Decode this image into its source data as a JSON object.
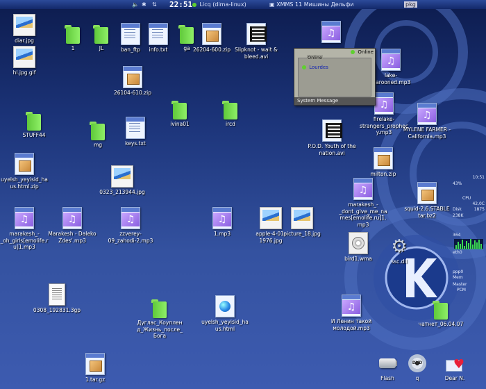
{
  "topbar": {
    "clock": "22:51",
    "licq_status": "Licq (dima-linux)",
    "xmms_label": "XMMS",
    "xmms_track": "11  Мишины Дельфи",
    "indicator": "pkg"
  },
  "licq": {
    "status": "Online",
    "group": "Online",
    "contact": "Lourdes",
    "footer": "System Message"
  },
  "sysmon": {
    "time": "10:51",
    "percent": "43%",
    "cpu": "CPU",
    "temp": "42,0C",
    "freq": "1875",
    "disk": "Disk",
    "ram": "238K",
    "net": "364",
    "eth0": "eth0",
    "ppp": "ppp0",
    "mem": "Mem",
    "master": "Master",
    "pcm": "PCM"
  },
  "icons": [
    {
      "label": "diar.jpg",
      "type": "img"
    },
    {
      "label": "hl.jpg.gif",
      "type": "img"
    },
    {
      "label": "1",
      "type": "folder"
    },
    {
      "label": "JL",
      "type": "folder"
    },
    {
      "label": "ban_ftp",
      "type": "doc"
    },
    {
      "label": "info.txt",
      "type": "doc"
    },
    {
      "label": "ga",
      "type": "folder"
    },
    {
      "label": "26204-600.zip",
      "type": "zip"
    },
    {
      "label": "Slipknot - wait & bleed.avi",
      "type": "avi"
    },
    {
      "label": "26104-610.zip",
      "type": "zip"
    },
    {
      "label": "STUFF44",
      "type": "folder"
    },
    {
      "label": "mg",
      "type": "folder"
    },
    {
      "label": "keys.txt",
      "type": "doc"
    },
    {
      "label": "ivina01",
      "type": "folder"
    },
    {
      "label": "ircd",
      "type": "folder"
    },
    {
      "label": "uyelsh_yeyisid_haus.html.zip",
      "type": "zip"
    },
    {
      "label": "0323_213944.jpg",
      "type": "img"
    },
    {
      "label": "marakesh_-_oh_girls[emolife.ru]1.mp3",
      "type": "mp3"
    },
    {
      "label": "Marakesh - Daleko Zdes'.mp3",
      "type": "mp3"
    },
    {
      "label": "zzverey-09_zahodi-2.mp3",
      "type": "mp3"
    },
    {
      "label": "1.mp3",
      "type": "mp3"
    },
    {
      "label": "apple-4-01-1976.jpg",
      "type": "img"
    },
    {
      "label": "picture_18.jpg",
      "type": "img"
    },
    {
      "label": "0308_192831.3gp",
      "type": "file"
    },
    {
      "label": "Дуглас_Коупленд_Жизнь_после_Бога",
      "type": "folder"
    },
    {
      "label": "uyelsh_yeyisid_haus.html",
      "type": "html"
    },
    {
      "label": "1.tar.gz",
      "type": "zip"
    },
    {
      "label": "",
      "type": "mp3"
    },
    {
      "label": "lake-Marooned.mp3",
      "type": "mp3"
    },
    {
      "label": "firelake-strangers_prophecy.mp3",
      "type": "mp3"
    },
    {
      "label": "MYLENE FARMER - California.mp3",
      "type": "mp3"
    },
    {
      "label": "P.O.D. Youth of the nation.avi",
      "type": "avi"
    },
    {
      "label": "milton.zip",
      "type": "zip"
    },
    {
      "label": "marakesh_-_dont_give_me_names[emolife.ru]1.mp3",
      "type": "mp3"
    },
    {
      "label": "squid-2.6.STABLE tar.bz2",
      "type": "zip"
    },
    {
      "label": "bird1.wma",
      "type": "wma"
    },
    {
      "label": "ssc.dll",
      "type": "gear"
    },
    {
      "label": "И Ленин такой молодой.mp3",
      "type": "mp3"
    },
    {
      "label": "чатнет_06.04.07",
      "type": "folder"
    },
    {
      "label": "Flash",
      "type": "flash"
    },
    {
      "label": "q",
      "type": "dvd"
    },
    {
      "label": "Dear N.",
      "type": "mail"
    }
  ]
}
